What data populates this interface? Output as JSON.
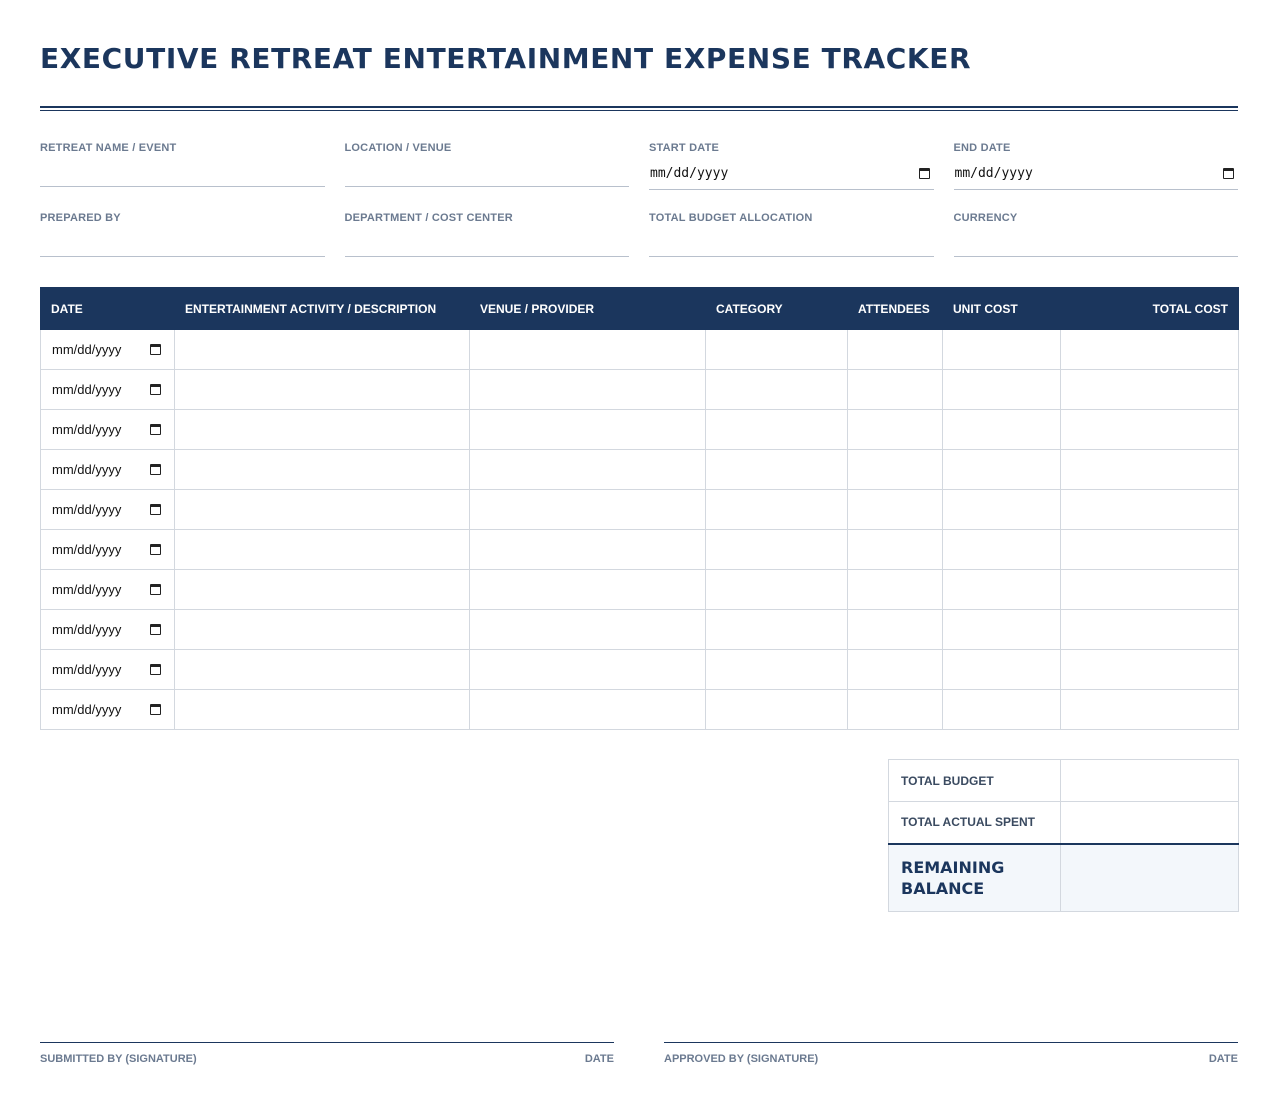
{
  "title": "EXECUTIVE RETREAT ENTERTAINMENT EXPENSE TRACKER",
  "fields": [
    {
      "label": "RETREAT NAME / EVENT",
      "type": "text",
      "value": ""
    },
    {
      "label": "LOCATION / VENUE",
      "type": "text",
      "value": ""
    },
    {
      "label": "START DATE",
      "type": "date",
      "value": "mm/dd/yyyy"
    },
    {
      "label": "END DATE",
      "type": "date",
      "value": "mm/dd/yyyy"
    },
    {
      "label": "PREPARED BY",
      "type": "text",
      "value": ""
    },
    {
      "label": "DEPARTMENT / COST CENTER",
      "type": "text",
      "value": ""
    },
    {
      "label": "TOTAL BUDGET ALLOCATION",
      "type": "text",
      "value": ""
    },
    {
      "label": "CURRENCY",
      "type": "text",
      "value": ""
    }
  ],
  "table": {
    "headers": [
      "DATE",
      "ENTERTAINMENT ACTIVITY / DESCRIPTION",
      "VENUE / PROVIDER",
      "CATEGORY",
      "ATTENDEES",
      "UNIT COST",
      "TOTAL COST"
    ],
    "rows": [
      [
        "mm/dd/yyyy",
        "",
        "",
        "",
        "",
        "",
        ""
      ],
      [
        "mm/dd/yyyy",
        "",
        "",
        "",
        "",
        "",
        ""
      ],
      [
        "mm/dd/yyyy",
        "",
        "",
        "",
        "",
        "",
        ""
      ],
      [
        "mm/dd/yyyy",
        "",
        "",
        "",
        "",
        "",
        ""
      ],
      [
        "mm/dd/yyyy",
        "",
        "",
        "",
        "",
        "",
        ""
      ],
      [
        "mm/dd/yyyy",
        "",
        "",
        "",
        "",
        "",
        ""
      ],
      [
        "mm/dd/yyyy",
        "",
        "",
        "",
        "",
        "",
        ""
      ],
      [
        "mm/dd/yyyy",
        "",
        "",
        "",
        "",
        "",
        ""
      ],
      [
        "mm/dd/yyyy",
        "",
        "",
        "",
        "",
        "",
        ""
      ],
      [
        "mm/dd/yyyy",
        "",
        "",
        "",
        "",
        "",
        ""
      ]
    ]
  },
  "summary": {
    "total_budget_label": "TOTAL BUDGET",
    "total_budget_value": "",
    "total_spent_label": "TOTAL ACTUAL SPENT",
    "total_spent_value": "",
    "remaining_label_line1": "REMAINING",
    "remaining_label_line2": "BALANCE",
    "remaining_value": ""
  },
  "signatures": {
    "submitted_label": "SUBMITTED BY (SIGNATURE)",
    "submitted_date_label": "DATE",
    "approved_label": "APPROVED BY (SIGNATURE)",
    "approved_date_label": "DATE"
  },
  "icons": {
    "date_picker": "calendar-icon"
  },
  "colors": {
    "primary": "#1b365d",
    "label": "#6b7a90",
    "border": "#d3d8df",
    "summary_bg": "#f3f7fb"
  }
}
